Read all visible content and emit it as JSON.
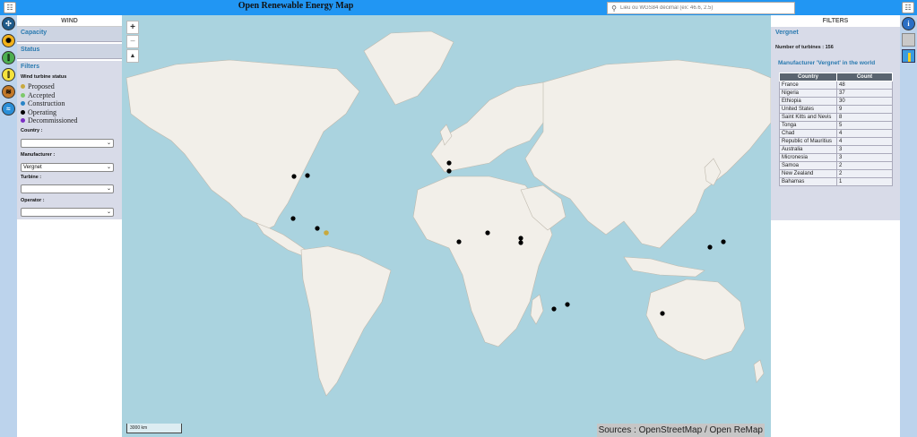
{
  "app": {
    "title": "Open Renewable Energy Map"
  },
  "search": {
    "placeholder": "Lieu ou WGS84 décimal (ex: 46.6, 2.5)"
  },
  "left_panel": {
    "title": "WIND",
    "sections": {
      "capacity": "Capacity",
      "status": "Status",
      "filters": "Filters"
    },
    "status_heading": "Wind turbine status",
    "legend": [
      {
        "label": "Proposed",
        "color": "#c8a93e"
      },
      {
        "label": "Accepted",
        "color": "#7dc96b"
      },
      {
        "label": "Construction",
        "color": "#2a84c6"
      },
      {
        "label": "Operating",
        "color": "#000000"
      },
      {
        "label": "Decommissioned",
        "color": "#7b2fc4"
      }
    ],
    "country_label": "Country :",
    "country_value": "",
    "manufacturer_label": "Manufacturer :",
    "manufacturer_value": "Vergnet",
    "turbine_label": "Turbine :",
    "turbine_value": "",
    "operator_label": "Operator :",
    "operator_value": ""
  },
  "map": {
    "zoom_in": "+",
    "zoom_out": "−",
    "north": "▲",
    "sources": "Sources : OpenStreetMap / Open ReMap",
    "scale": "3000 km"
  },
  "right_panel": {
    "title": "FILTERS",
    "manufacturer": "Vergnet",
    "turbine_count": "Number of turbines : 156",
    "world_title": "Manufacturer 'Vergnet' in the world",
    "table_headers": [
      "Country",
      "Count"
    ],
    "table_rows": [
      [
        "France",
        "48"
      ],
      [
        "Nigeria",
        "37"
      ],
      [
        "Ethiopia",
        "30"
      ],
      [
        "United States",
        "9"
      ],
      [
        "Saint Kitts and Nevis",
        "8"
      ],
      [
        "Tonga",
        "5"
      ],
      [
        "Chad",
        "4"
      ],
      [
        "Republic of Mauritius",
        "4"
      ],
      [
        "Australia",
        "3"
      ],
      [
        "Micronesia",
        "3"
      ],
      [
        "Samoa",
        "2"
      ],
      [
        "New Zealand",
        "2"
      ],
      [
        "Bahamas",
        "1"
      ]
    ]
  },
  "colors": {
    "topbar": "#2196f3",
    "accent": "#2a7ab0",
    "water": "#aad3df",
    "land": "#f2efe9"
  }
}
